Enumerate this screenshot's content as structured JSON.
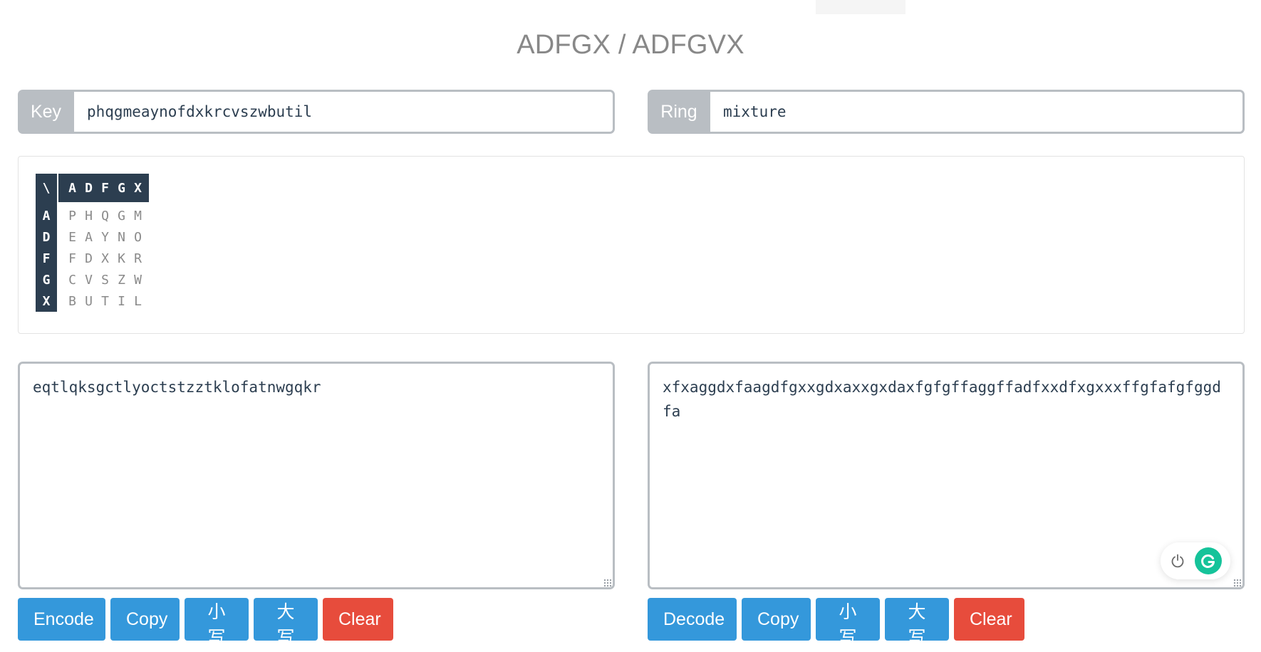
{
  "page": {
    "title": "ADFGX / ADFGVX"
  },
  "key": {
    "label": "Key",
    "value": "phqgmeaynofdxkrcvszwbutil"
  },
  "ring": {
    "label": "Ring",
    "value": "mixture"
  },
  "square": {
    "corner": "\\",
    "columns": [
      "A",
      "D",
      "F",
      "G",
      "X"
    ],
    "rows": [
      {
        "label": "A",
        "cells": [
          "P",
          "H",
          "Q",
          "G",
          "M"
        ]
      },
      {
        "label": "D",
        "cells": [
          "E",
          "A",
          "Y",
          "N",
          "O"
        ]
      },
      {
        "label": "F",
        "cells": [
          "F",
          "D",
          "X",
          "K",
          "R"
        ]
      },
      {
        "label": "G",
        "cells": [
          "C",
          "V",
          "S",
          "Z",
          "W"
        ]
      },
      {
        "label": "X",
        "cells": [
          "B",
          "U",
          "T",
          "I",
          "L"
        ]
      }
    ]
  },
  "plaintext": {
    "value": "eqtlqksgctlyoctstzztklofatnwgqkr"
  },
  "ciphertext": {
    "value": "xfxaggdxfaagdfgxxgdxaxxgxdaxfgfgffaggffadfxxdfxgxxxffgfafgfggdfa"
  },
  "left_buttons": {
    "encode": "Encode",
    "copy": "Copy",
    "lower": "小写",
    "upper": "大写",
    "clear": "Clear"
  },
  "right_buttons": {
    "decode": "Decode",
    "copy": "Copy",
    "lower": "小写",
    "upper": "大写",
    "clear": "Clear"
  },
  "colors": {
    "primary": "#3498db",
    "danger": "#e74c3c",
    "dark": "#2c3e50",
    "addon": "#b9bec3",
    "grammarly": "#15c39a"
  },
  "icons": {
    "power": "power-icon",
    "grammarly": "grammarly-icon"
  }
}
